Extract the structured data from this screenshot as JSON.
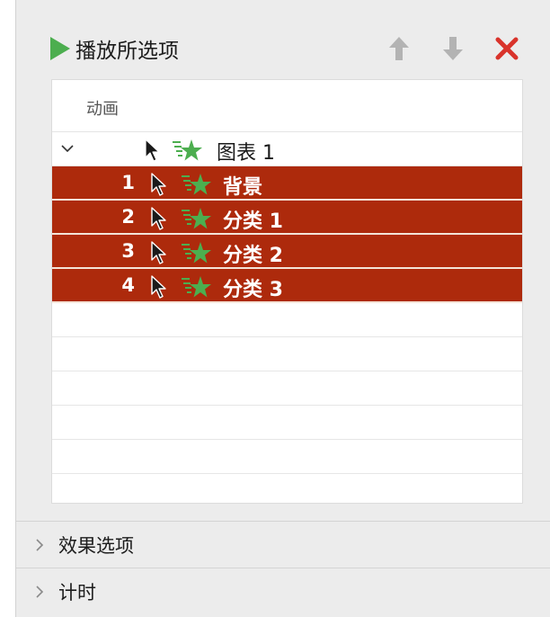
{
  "toolbar": {
    "play_label": "播放所选项",
    "play_icon": "play-icon",
    "move_up_icon": "arrow-up-icon",
    "move_down_icon": "arrow-down-icon",
    "delete_icon": "close-icon",
    "colors": {
      "play": "#4cae4f",
      "arrows": "#b3b3b3",
      "delete": "#d9332b"
    }
  },
  "animation_list": {
    "header": "动画",
    "group": {
      "label": "图表 1",
      "expanded": true
    },
    "items": [
      {
        "order": "1",
        "label": "背景",
        "selected": true
      },
      {
        "order": "2",
        "label": "分类 1",
        "selected": true
      },
      {
        "order": "3",
        "label": "分类 2",
        "selected": true
      },
      {
        "order": "4",
        "label": "分类 3",
        "selected": true
      }
    ],
    "colors": {
      "selected_row": "#ad2a0c",
      "effect_star": "#4cae4f"
    }
  },
  "sections": [
    {
      "label": "效果选项",
      "expanded": false
    },
    {
      "label": "计时",
      "expanded": false
    }
  ]
}
